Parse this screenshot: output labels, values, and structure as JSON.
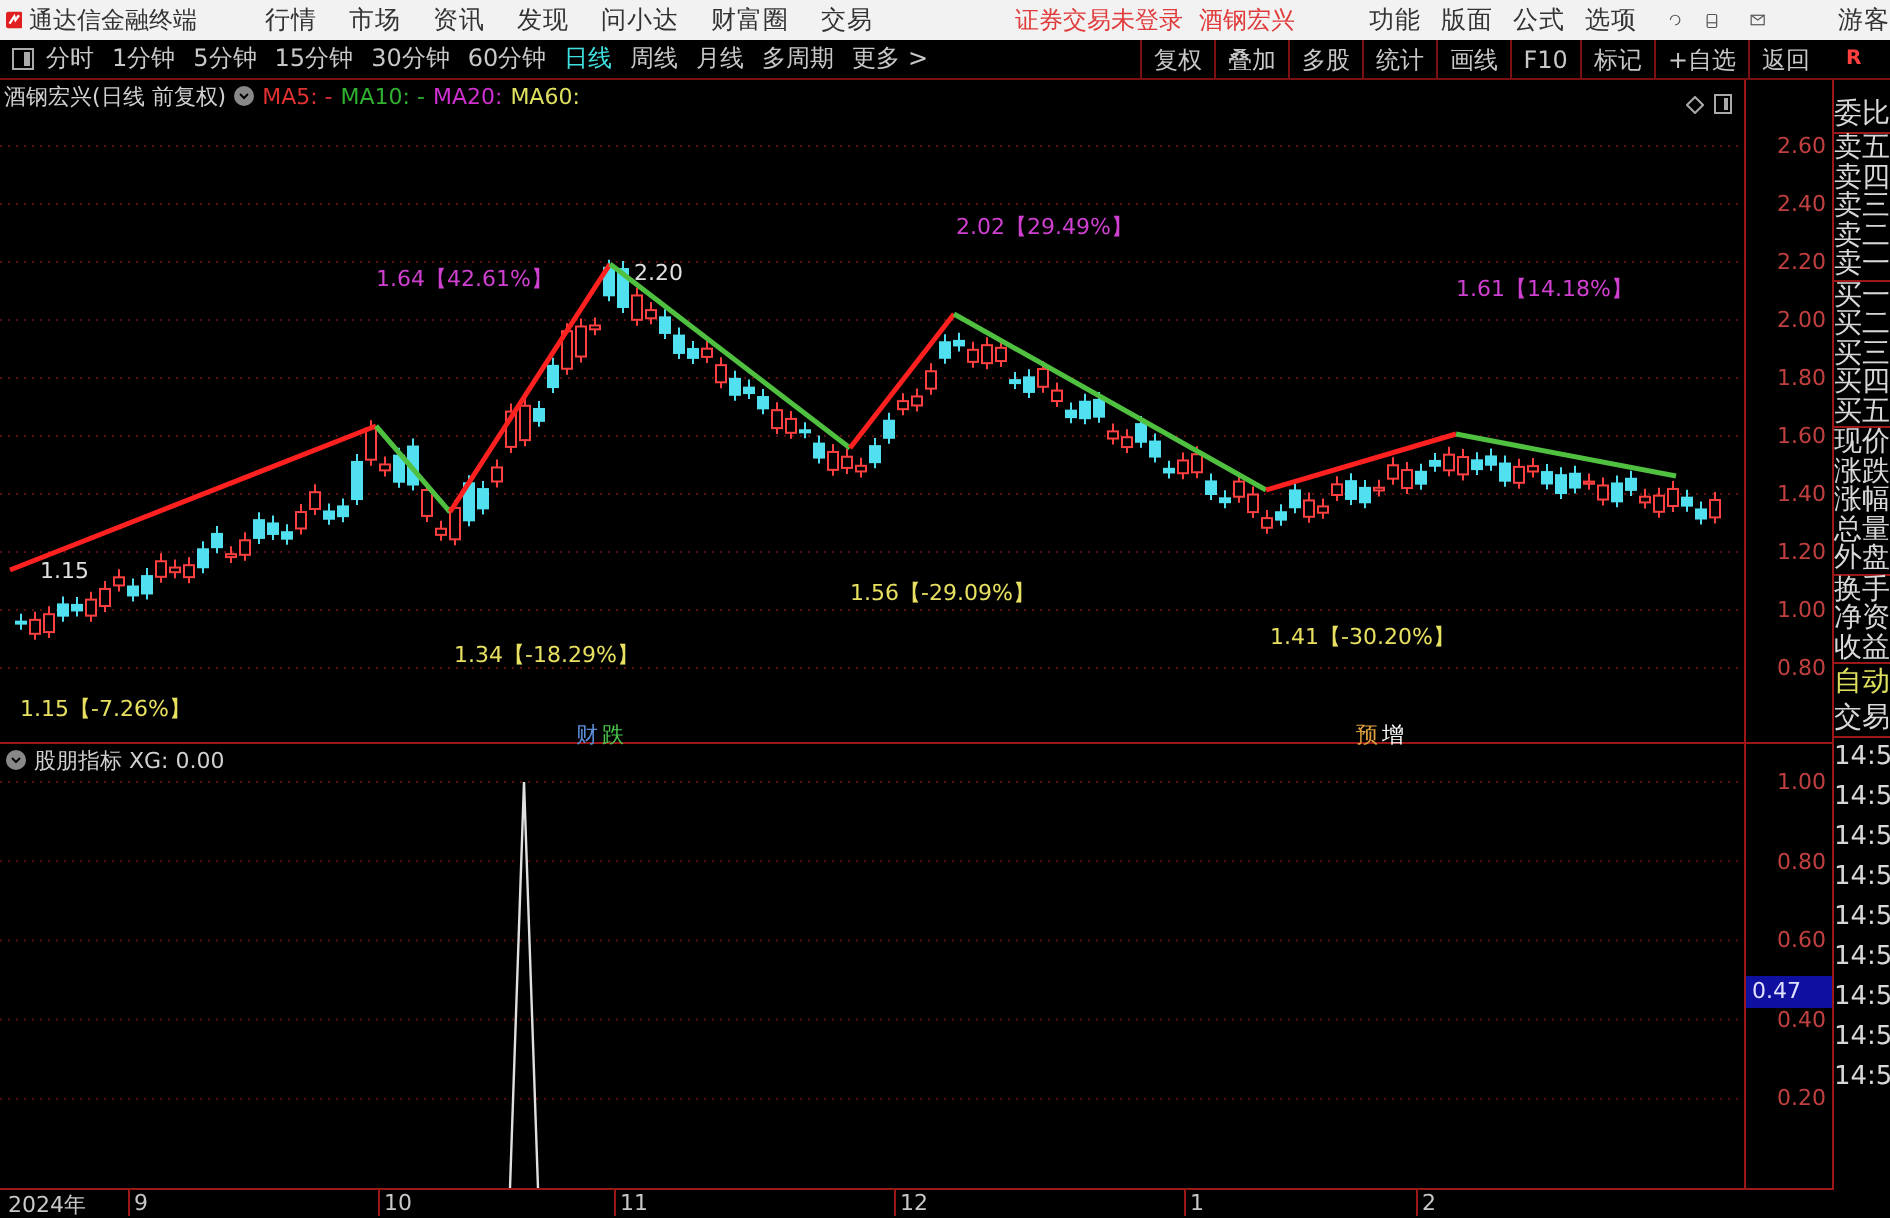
{
  "menubar": {
    "app_title": "通达信金融终端",
    "menus": [
      "行情",
      "市场",
      "资讯",
      "发现",
      "问小达",
      "财富圈",
      "交易"
    ],
    "notices": [
      "证券交易未登录",
      "酒钢宏兴"
    ],
    "right_menus": [
      "功能",
      "版面",
      "公式",
      "选项"
    ],
    "user": "游客"
  },
  "toolbar": {
    "periods": [
      {
        "label": "分时",
        "selected": false
      },
      {
        "label": "1分钟",
        "selected": false
      },
      {
        "label": "5分钟",
        "selected": false
      },
      {
        "label": "15分钟",
        "selected": false
      },
      {
        "label": "30分钟",
        "selected": false
      },
      {
        "label": "60分钟",
        "selected": false
      },
      {
        "label": "日线",
        "selected": true
      },
      {
        "label": "周线",
        "selected": false
      },
      {
        "label": "月线",
        "selected": false
      },
      {
        "label": "多周期",
        "selected": false
      }
    ],
    "more": "更多 >",
    "actions": [
      "复权",
      "叠加",
      "多股",
      "统计",
      "画线",
      "F10",
      "标记",
      "+自选",
      "返回"
    ],
    "corner": "R"
  },
  "main_chart": {
    "title": "酒钢宏兴(日线 前复权)",
    "ma": [
      {
        "label": "MA5: -",
        "color": "#e03030"
      },
      {
        "label": "MA10: -",
        "color": "#30b030"
      },
      {
        "label": "MA20:",
        "color": "#d030d0"
      },
      {
        "label": "MA60:",
        "color": "#e0e060"
      }
    ],
    "y_ticks": [
      "2.60",
      "2.40",
      "2.20",
      "2.00",
      "1.80",
      "1.60",
      "1.40",
      "1.20",
      "1.00",
      "0.80"
    ],
    "pivot_labels": [
      {
        "text": "2.02【29.49%】",
        "kind": "high"
      },
      {
        "text": "1.64【42.61%】",
        "kind": "high"
      },
      {
        "text": "2.20",
        "kind": "price"
      },
      {
        "text": "1.61【14.18%】",
        "kind": "high"
      },
      {
        "text": "1.15",
        "kind": "price"
      },
      {
        "text": "1.56【-29.09%】",
        "kind": "low"
      },
      {
        "text": "1.34【-18.29%】",
        "kind": "low"
      },
      {
        "text": "1.41【-30.20%】",
        "kind": "low"
      },
      {
        "text": "1.15【-7.26%】",
        "kind": "low"
      }
    ],
    "event_marks": [
      {
        "text": "财",
        "color": "#5b8fd9"
      },
      {
        "text": "跌",
        "color": "#4cc84c"
      },
      {
        "text": "预",
        "color": "#e0a040"
      },
      {
        "text": "增",
        "color": "#ffffff"
      }
    ]
  },
  "indicator": {
    "title": "股朋指标 XG: 0.00",
    "y_ticks": [
      "1.00",
      "0.80",
      "0.60",
      "0.40",
      "0.20"
    ],
    "current": "0.47"
  },
  "x_axis": [
    "2024年",
    "9",
    "10",
    "11",
    "12",
    "1",
    "2"
  ],
  "quote_panel": {
    "groups": [
      [
        "委比"
      ],
      [
        "卖五",
        "卖四",
        "卖三",
        "卖二",
        "卖一"
      ],
      [
        "买一",
        "买二",
        "买三",
        "买四",
        "买五"
      ],
      [
        "现价",
        "涨跌",
        "涨幅",
        "总量",
        "外盘"
      ],
      [
        "换手",
        "净资",
        "收益"
      ]
    ],
    "auto": "自动",
    "trade": "交易",
    "times": [
      "14:5",
      "14:5",
      "14:5",
      "14:5",
      "14:5",
      "14:5",
      "14:5",
      "14:5",
      "14:5"
    ]
  }
}
